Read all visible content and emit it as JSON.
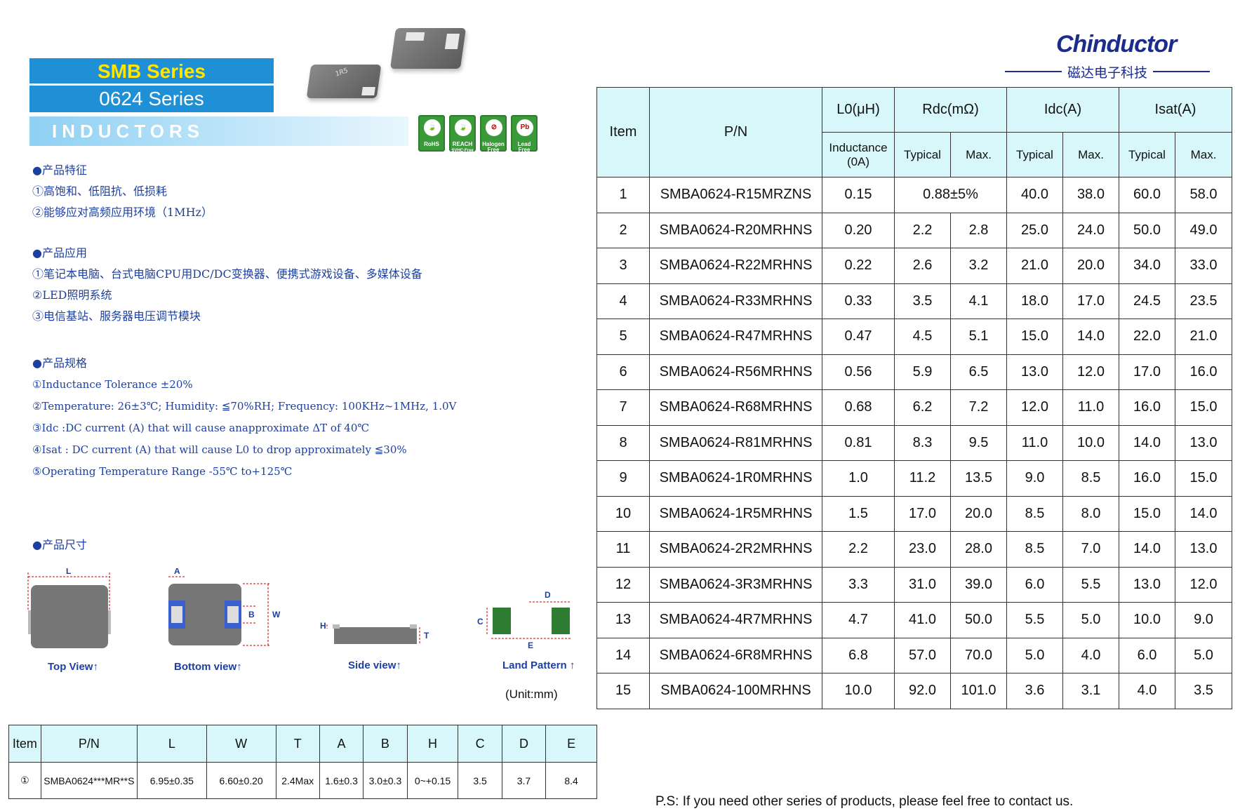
{
  "header": {
    "series_line1": "SMB Series",
    "series_line2": "0624 Series",
    "category": "INDUCTORS",
    "chip_marking": "1R5"
  },
  "badges": [
    {
      "label": "RoHS",
      "sub": ""
    },
    {
      "label": "REACH",
      "sub": "SVHC-Free"
    },
    {
      "label": "Halogen",
      "sub": "Free"
    },
    {
      "label": "Lead",
      "sub": "Free"
    }
  ],
  "logo": {
    "brand": "Chinductor",
    "subtitle": "磁达电子科技"
  },
  "features": {
    "heading": "●产品特征",
    "items": [
      "①高饱和、低阻抗、低损耗",
      "②能够应对高频应用环境（1MHz）"
    ]
  },
  "applications": {
    "heading": "●产品应用",
    "items": [
      "①笔记本电脑、台式电脑CPU用DC/DC变换器、便携式游戏设备、多媒体设备",
      "②LED照明系统",
      "③电信基站、服务器电压调节模块"
    ]
  },
  "specs": {
    "heading": "●产品规格",
    "items": [
      "①Inductance Tolerance ±20%",
      "②Temperature: 26±3℃; Humidity: ≦70%RH; Frequency: 100KHz~1MHz, 1.0V",
      "③Idc :DC current (A) that will cause anapproximate ΔT of 40℃",
      "④Isat : DC current (A) that will cause L0 to drop approximately ≦30%",
      "⑤Operating Temperature Range -55℃ to+125℃"
    ]
  },
  "dimensions": {
    "heading": "●产品尺寸",
    "views": [
      "Top View↑",
      "Bottom view↑",
      "Side view↑",
      "Land Pattern ↑"
    ],
    "letters": {
      "L": "L",
      "A": "A",
      "B": "B",
      "W": "W",
      "H": "H",
      "T": "T",
      "C": "C",
      "D": "D",
      "E": "E"
    },
    "unit": "(Unit:mm)"
  },
  "main_table": {
    "headers": {
      "item": "Item",
      "pn": "P/N",
      "l0": "L0(μH)",
      "rdc": "Rdc(mΩ)",
      "idc": "Idc(A)",
      "isat": "Isat(A)",
      "inductance": "Inductance (0A)",
      "typical": "Typical",
      "max": "Max."
    },
    "rows": [
      [
        "1",
        "SMBA0624-R15MRZNS",
        "0.15",
        "0.88±5%",
        "",
        "40.0",
        "38.0",
        "60.0",
        "58.0"
      ],
      [
        "2",
        "SMBA0624-R20MRHNS",
        "0.20",
        "2.2",
        "2.8",
        "25.0",
        "24.0",
        "50.0",
        "49.0"
      ],
      [
        "3",
        "SMBA0624-R22MRHNS",
        "0.22",
        "2.6",
        "3.2",
        "21.0",
        "20.0",
        "34.0",
        "33.0"
      ],
      [
        "4",
        "SMBA0624-R33MRHNS",
        "0.33",
        "3.5",
        "4.1",
        "18.0",
        "17.0",
        "24.5",
        "23.5"
      ],
      [
        "5",
        "SMBA0624-R47MRHNS",
        "0.47",
        "4.5",
        "5.1",
        "15.0",
        "14.0",
        "22.0",
        "21.0"
      ],
      [
        "6",
        "SMBA0624-R56MRHNS",
        "0.56",
        "5.9",
        "6.5",
        "13.0",
        "12.0",
        "17.0",
        "16.0"
      ],
      [
        "7",
        "SMBA0624-R68MRHNS",
        "0.68",
        "6.2",
        "7.2",
        "12.0",
        "11.0",
        "16.0",
        "15.0"
      ],
      [
        "8",
        "SMBA0624-R81MRHNS",
        "0.81",
        "8.3",
        "9.5",
        "11.0",
        "10.0",
        "14.0",
        "13.0"
      ],
      [
        "9",
        "SMBA0624-1R0MRHNS",
        "1.0",
        "11.2",
        "13.5",
        "9.0",
        "8.5",
        "16.0",
        "15.0"
      ],
      [
        "10",
        "SMBA0624-1R5MRHNS",
        "1.5",
        "17.0",
        "20.0",
        "8.5",
        "8.0",
        "15.0",
        "14.0"
      ],
      [
        "11",
        "SMBA0624-2R2MRHNS",
        "2.2",
        "23.0",
        "28.0",
        "8.5",
        "7.0",
        "14.0",
        "13.0"
      ],
      [
        "12",
        "SMBA0624-3R3MRHNS",
        "3.3",
        "31.0",
        "39.0",
        "6.0",
        "5.5",
        "13.0",
        "12.0"
      ],
      [
        "13",
        "SMBA0624-4R7MRHNS",
        "4.7",
        "41.0",
        "50.0",
        "5.5",
        "5.0",
        "10.0",
        "9.0"
      ],
      [
        "14",
        "SMBA0624-6R8MRHNS",
        "6.8",
        "57.0",
        "70.0",
        "5.0",
        "4.0",
        "6.0",
        "5.0"
      ],
      [
        "15",
        "SMBA0624-100MRHNS",
        "10.0",
        "92.0",
        "101.0",
        "3.6",
        "3.1",
        "4.0",
        "3.5"
      ]
    ]
  },
  "dim_table": {
    "headers": [
      "Item",
      "P/N",
      "L",
      "W",
      "T",
      "A",
      "B",
      "H",
      "C",
      "D",
      "E"
    ],
    "row": [
      "①",
      "SMBA0624***MR**S",
      "6.95±0.35",
      "6.60±0.20",
      "2.4Max",
      "1.6±0.3",
      "3.0±0.3",
      "0~+0.15",
      "3.5",
      "3.7",
      "8.4"
    ]
  },
  "footer": {
    "note": "P.S: If you need other series of products, please feel free to contact us."
  },
  "colors": {
    "header_blue": "#1f8fd6",
    "series_yellow": "#ffe600",
    "table_header_bg": "#d8f7fb",
    "text_blue": "#1d3fa0",
    "logo_blue": "#1b2c8c",
    "badge_green": "#3a9a3a",
    "pad_green": "#2e7d32"
  }
}
